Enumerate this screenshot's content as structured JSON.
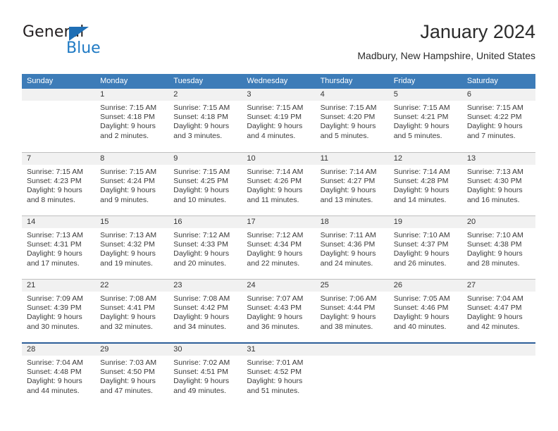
{
  "brand": {
    "name_top": "General",
    "name_bottom": "Blue",
    "triangle_color": "#1f6fb5",
    "blue_color": "#1f7ac4"
  },
  "header": {
    "title": "January 2024",
    "subtitle": "Madbury, New Hampshire, United States",
    "header_bg": "#3d7cb8"
  },
  "calendar": {
    "weekday_headers": [
      "Sunday",
      "Monday",
      "Tuesday",
      "Wednesday",
      "Thursday",
      "Friday",
      "Saturday"
    ],
    "weeks": [
      [
        {
          "day": "",
          "lines": []
        },
        {
          "day": "1",
          "lines": [
            "Sunrise: 7:15 AM",
            "Sunset: 4:18 PM",
            "Daylight: 9 hours",
            "and 2 minutes."
          ]
        },
        {
          "day": "2",
          "lines": [
            "Sunrise: 7:15 AM",
            "Sunset: 4:18 PM",
            "Daylight: 9 hours",
            "and 3 minutes."
          ]
        },
        {
          "day": "3",
          "lines": [
            "Sunrise: 7:15 AM",
            "Sunset: 4:19 PM",
            "Daylight: 9 hours",
            "and 4 minutes."
          ]
        },
        {
          "day": "4",
          "lines": [
            "Sunrise: 7:15 AM",
            "Sunset: 4:20 PM",
            "Daylight: 9 hours",
            "and 5 minutes."
          ]
        },
        {
          "day": "5",
          "lines": [
            "Sunrise: 7:15 AM",
            "Sunset: 4:21 PM",
            "Daylight: 9 hours",
            "and 5 minutes."
          ]
        },
        {
          "day": "6",
          "lines": [
            "Sunrise: 7:15 AM",
            "Sunset: 4:22 PM",
            "Daylight: 9 hours",
            "and 7 minutes."
          ]
        }
      ],
      [
        {
          "day": "7",
          "lines": [
            "Sunrise: 7:15 AM",
            "Sunset: 4:23 PM",
            "Daylight: 9 hours",
            "and 8 minutes."
          ]
        },
        {
          "day": "8",
          "lines": [
            "Sunrise: 7:15 AM",
            "Sunset: 4:24 PM",
            "Daylight: 9 hours",
            "and 9 minutes."
          ]
        },
        {
          "day": "9",
          "lines": [
            "Sunrise: 7:15 AM",
            "Sunset: 4:25 PM",
            "Daylight: 9 hours",
            "and 10 minutes."
          ]
        },
        {
          "day": "10",
          "lines": [
            "Sunrise: 7:14 AM",
            "Sunset: 4:26 PM",
            "Daylight: 9 hours",
            "and 11 minutes."
          ]
        },
        {
          "day": "11",
          "lines": [
            "Sunrise: 7:14 AM",
            "Sunset: 4:27 PM",
            "Daylight: 9 hours",
            "and 13 minutes."
          ]
        },
        {
          "day": "12",
          "lines": [
            "Sunrise: 7:14 AM",
            "Sunset: 4:28 PM",
            "Daylight: 9 hours",
            "and 14 minutes."
          ]
        },
        {
          "day": "13",
          "lines": [
            "Sunrise: 7:13 AM",
            "Sunset: 4:30 PM",
            "Daylight: 9 hours",
            "and 16 minutes."
          ]
        }
      ],
      [
        {
          "day": "14",
          "lines": [
            "Sunrise: 7:13 AM",
            "Sunset: 4:31 PM",
            "Daylight: 9 hours",
            "and 17 minutes."
          ]
        },
        {
          "day": "15",
          "lines": [
            "Sunrise: 7:13 AM",
            "Sunset: 4:32 PM",
            "Daylight: 9 hours",
            "and 19 minutes."
          ]
        },
        {
          "day": "16",
          "lines": [
            "Sunrise: 7:12 AM",
            "Sunset: 4:33 PM",
            "Daylight: 9 hours",
            "and 20 minutes."
          ]
        },
        {
          "day": "17",
          "lines": [
            "Sunrise: 7:12 AM",
            "Sunset: 4:34 PM",
            "Daylight: 9 hours",
            "and 22 minutes."
          ]
        },
        {
          "day": "18",
          "lines": [
            "Sunrise: 7:11 AM",
            "Sunset: 4:36 PM",
            "Daylight: 9 hours",
            "and 24 minutes."
          ]
        },
        {
          "day": "19",
          "lines": [
            "Sunrise: 7:10 AM",
            "Sunset: 4:37 PM",
            "Daylight: 9 hours",
            "and 26 minutes."
          ]
        },
        {
          "day": "20",
          "lines": [
            "Sunrise: 7:10 AM",
            "Sunset: 4:38 PM",
            "Daylight: 9 hours",
            "and 28 minutes."
          ]
        }
      ],
      [
        {
          "day": "21",
          "lines": [
            "Sunrise: 7:09 AM",
            "Sunset: 4:39 PM",
            "Daylight: 9 hours",
            "and 30 minutes."
          ]
        },
        {
          "day": "22",
          "lines": [
            "Sunrise: 7:08 AM",
            "Sunset: 4:41 PM",
            "Daylight: 9 hours",
            "and 32 minutes."
          ]
        },
        {
          "day": "23",
          "lines": [
            "Sunrise: 7:08 AM",
            "Sunset: 4:42 PM",
            "Daylight: 9 hours",
            "and 34 minutes."
          ]
        },
        {
          "day": "24",
          "lines": [
            "Sunrise: 7:07 AM",
            "Sunset: 4:43 PM",
            "Daylight: 9 hours",
            "and 36 minutes."
          ]
        },
        {
          "day": "25",
          "lines": [
            "Sunrise: 7:06 AM",
            "Sunset: 4:44 PM",
            "Daylight: 9 hours",
            "and 38 minutes."
          ]
        },
        {
          "day": "26",
          "lines": [
            "Sunrise: 7:05 AM",
            "Sunset: 4:46 PM",
            "Daylight: 9 hours",
            "and 40 minutes."
          ]
        },
        {
          "day": "27",
          "lines": [
            "Sunrise: 7:04 AM",
            "Sunset: 4:47 PM",
            "Daylight: 9 hours",
            "and 42 minutes."
          ]
        }
      ],
      [
        {
          "day": "28",
          "lines": [
            "Sunrise: 7:04 AM",
            "Sunset: 4:48 PM",
            "Daylight: 9 hours",
            "and 44 minutes."
          ]
        },
        {
          "day": "29",
          "lines": [
            "Sunrise: 7:03 AM",
            "Sunset: 4:50 PM",
            "Daylight: 9 hours",
            "and 47 minutes."
          ]
        },
        {
          "day": "30",
          "lines": [
            "Sunrise: 7:02 AM",
            "Sunset: 4:51 PM",
            "Daylight: 9 hours",
            "and 49 minutes."
          ]
        },
        {
          "day": "31",
          "lines": [
            "Sunrise: 7:01 AM",
            "Sunset: 4:52 PM",
            "Daylight: 9 hours",
            "and 51 minutes."
          ]
        },
        {
          "day": "",
          "lines": []
        },
        {
          "day": "",
          "lines": []
        },
        {
          "day": "",
          "lines": []
        }
      ]
    ]
  }
}
